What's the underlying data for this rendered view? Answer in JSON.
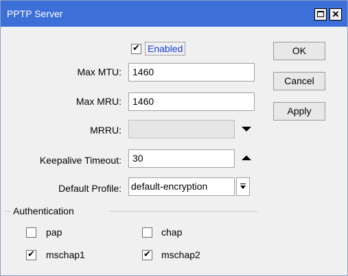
{
  "window": {
    "title": "PPTP Server"
  },
  "enabled": {
    "label": "Enabled",
    "checked": true
  },
  "fields": {
    "max_mtu": {
      "label": "Max MTU:",
      "value": "1460"
    },
    "max_mru": {
      "label": "Max MRU:",
      "value": "1460"
    },
    "mrru": {
      "label": "MRRU:",
      "value": ""
    },
    "keepalive": {
      "label": "Keepalive Timeout:",
      "value": "30"
    },
    "default_profile": {
      "label": "Default Profile:",
      "value": "default-encryption"
    }
  },
  "buttons": {
    "ok": "OK",
    "cancel": "Cancel",
    "apply": "Apply"
  },
  "authentication": {
    "title": "Authentication",
    "pap": {
      "label": "pap",
      "checked": false
    },
    "chap": {
      "label": "chap",
      "checked": false
    },
    "mschap1": {
      "label": "mschap1",
      "checked": true
    },
    "mschap2": {
      "label": "mschap2",
      "checked": true
    }
  },
  "icons": {
    "check": "✔"
  },
  "colors": {
    "titlebar": "#3c6fd8",
    "link": "#1a3fd1"
  }
}
